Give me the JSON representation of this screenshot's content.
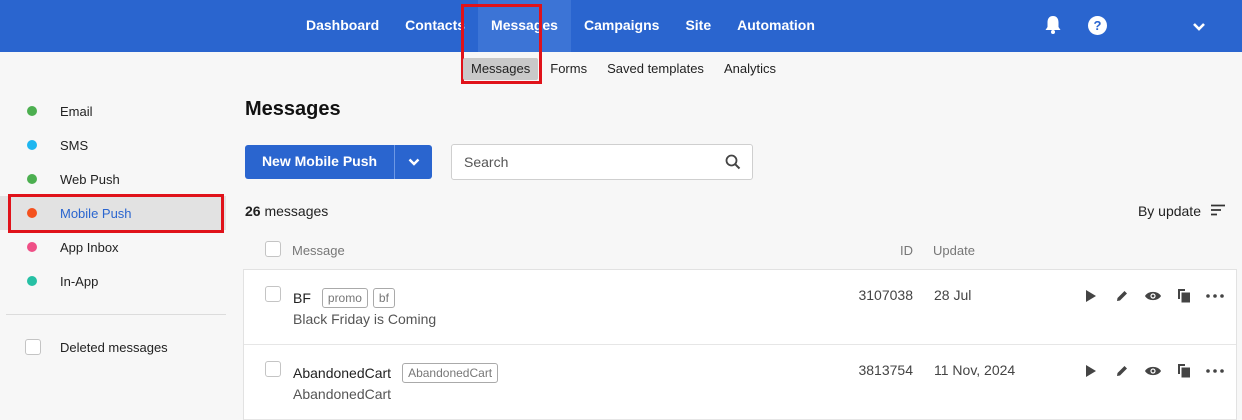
{
  "topnav": {
    "items": [
      "Dashboard",
      "Contacts",
      "Messages",
      "Campaigns",
      "Site",
      "Automation"
    ],
    "help_glyph": "?",
    "icons": {
      "notifications": "bell-icon",
      "help": "help-icon",
      "account_menu": "chevron-down-icon"
    }
  },
  "subnav": {
    "items": [
      "Messages",
      "Forms",
      "Saved templates",
      "Analytics"
    ]
  },
  "sidebar": {
    "items": [
      {
        "label": "Email",
        "color": "#4caf50"
      },
      {
        "label": "SMS",
        "color": "#1eb6f0"
      },
      {
        "label": "Web Push",
        "color": "#4caf50"
      },
      {
        "label": "Mobile Push",
        "color": "#f4511e"
      },
      {
        "label": "App Inbox",
        "color": "#ef4f86"
      },
      {
        "label": "In-App",
        "color": "#26c0a4"
      }
    ],
    "deleted_label": "Deleted messages"
  },
  "main": {
    "title": "Messages",
    "new_button_label": "New Mobile Push",
    "search_placeholder": "Search",
    "count_number": "26",
    "count_suffix": "messages",
    "sort_label": "By update",
    "columns": {
      "message": "Message",
      "id": "ID",
      "update": "Update"
    },
    "rows": [
      {
        "name": "BF",
        "tags": [
          "promo",
          "bf"
        ],
        "subtitle": "Black Friday is Coming",
        "id": "3107038",
        "update": "28 Jul"
      },
      {
        "name": "AbandonedCart",
        "tags": [
          "AbandonedCart"
        ],
        "subtitle": "AbandonedCart",
        "id": "3813754",
        "update": "11 Nov, 2024"
      }
    ],
    "row_actions": [
      "play-icon",
      "edit-icon",
      "preview-icon",
      "copy-icon",
      "more-icon"
    ]
  },
  "colors": {
    "brand": "#2a65cf",
    "highlight": "#e0121a"
  }
}
